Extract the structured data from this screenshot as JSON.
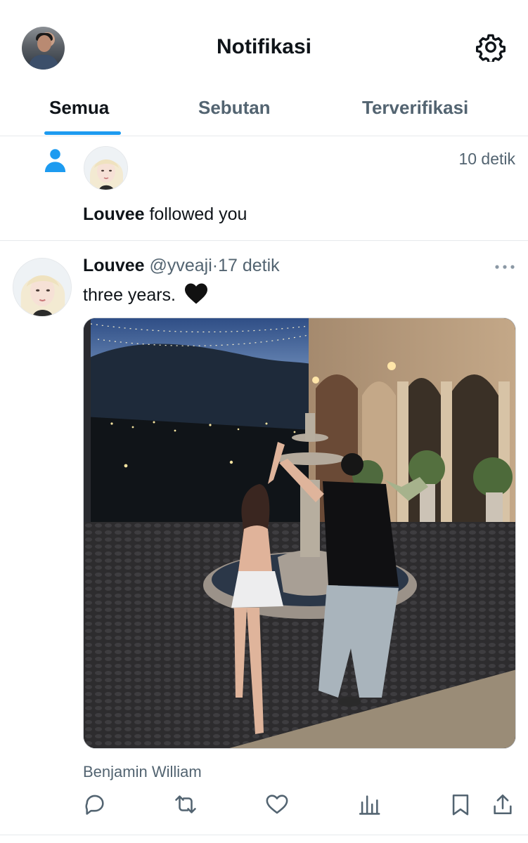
{
  "header": {
    "title": "Notifikasi",
    "avatar_icon": "profile-avatar",
    "settings_icon": "gear-icon"
  },
  "tabs": [
    {
      "label": "Semua",
      "active": true
    },
    {
      "label": "Sebutan",
      "active": false
    },
    {
      "label": "Terverifikasi",
      "active": false
    }
  ],
  "notification": {
    "icon": "person-icon",
    "time": "10 detik",
    "user": "Louvee",
    "action": " followed you"
  },
  "tweet": {
    "name": "Louvee",
    "handle": "@yveaji",
    "separator": "·",
    "time": "17 detik",
    "text": "three years.",
    "emoji": "black-heart",
    "caption": "Benjamin William",
    "actions": [
      "reply-icon",
      "retweet-icon",
      "like-icon",
      "views-icon",
      "bookmark-icon",
      "share-icon"
    ]
  },
  "colors": {
    "accent": "#1d9bf0",
    "text": "#0f1419",
    "muted": "#536471",
    "divider": "#e6e9ec"
  }
}
